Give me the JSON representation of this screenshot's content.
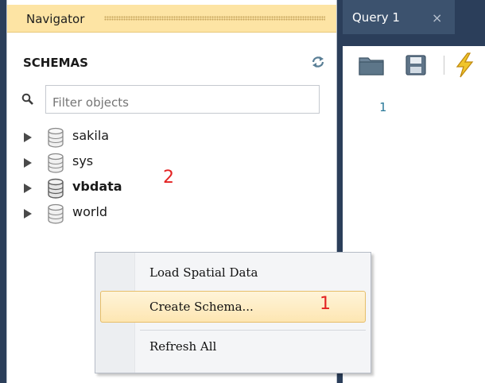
{
  "navigator": {
    "title": "Navigator",
    "section_label": "SCHEMAS",
    "filter_placeholder": "Filter objects",
    "schemas": [
      {
        "name": "sakila",
        "bold": false
      },
      {
        "name": "sys",
        "bold": false
      },
      {
        "name": "vbdata",
        "bold": true
      },
      {
        "name": "world",
        "bold": false
      }
    ]
  },
  "query": {
    "tab_label": "Query 1",
    "tab_close": "×",
    "line_number": "1"
  },
  "context_menu": {
    "items": [
      "Load Spatial Data",
      "Create Schema...",
      "Refresh All"
    ],
    "highlighted": "Create Schema..."
  },
  "annotations": {
    "step1": "1",
    "step2": "2",
    "color": "#e32222"
  },
  "colors": {
    "navigator_header": "#fde4a4",
    "highlight_border": "#e6be6a",
    "tab_background": "#3c526e",
    "window_background": "#2b3e5a"
  },
  "icons": {
    "refresh": "refresh-arrows-icon",
    "search": "magnifier-icon",
    "schema": "database-icon",
    "expand": "triangle-right-icon",
    "open": "folder-icon",
    "save": "floppy-disk-icon",
    "execute": "lightning-icon"
  }
}
